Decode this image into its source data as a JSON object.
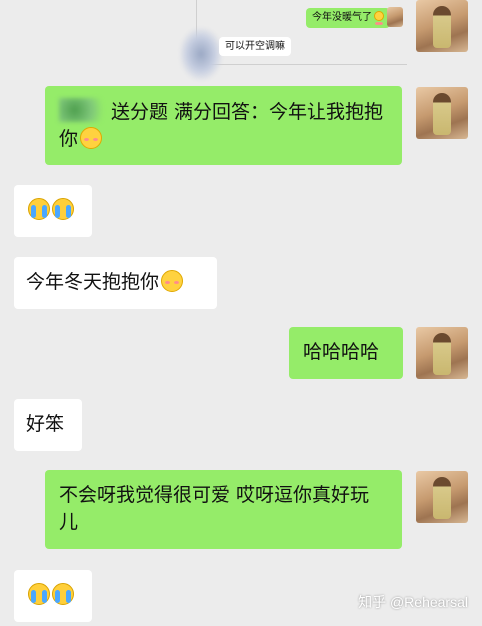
{
  "conversation": {
    "quoted": {
      "bubble_text": "今年没暖气了",
      "note_text": "可以开空调嘛"
    },
    "messages": [
      {
        "side": "right",
        "text": "送分题 满分回答：今年让我抱抱你",
        "emoji": "blush"
      },
      {
        "side": "left",
        "text": "",
        "emoji": "cry-cry"
      },
      {
        "side": "left",
        "text": "今年冬天抱抱你",
        "emoji": "blush"
      },
      {
        "side": "right",
        "text": "哈哈哈哈",
        "emoji": ""
      },
      {
        "side": "left",
        "text": "好笨",
        "emoji": ""
      },
      {
        "side": "right",
        "text": "不会呀我觉得很可爱 哎呀逗你真好玩儿",
        "emoji": ""
      },
      {
        "side": "left",
        "text": "",
        "emoji": "cry-cry"
      }
    ]
  },
  "watermark": "知乎 @Rehearsal",
  "colors": {
    "background": "#ececec",
    "sent_bubble": "#95ec69",
    "received_bubble": "#ffffff"
  }
}
